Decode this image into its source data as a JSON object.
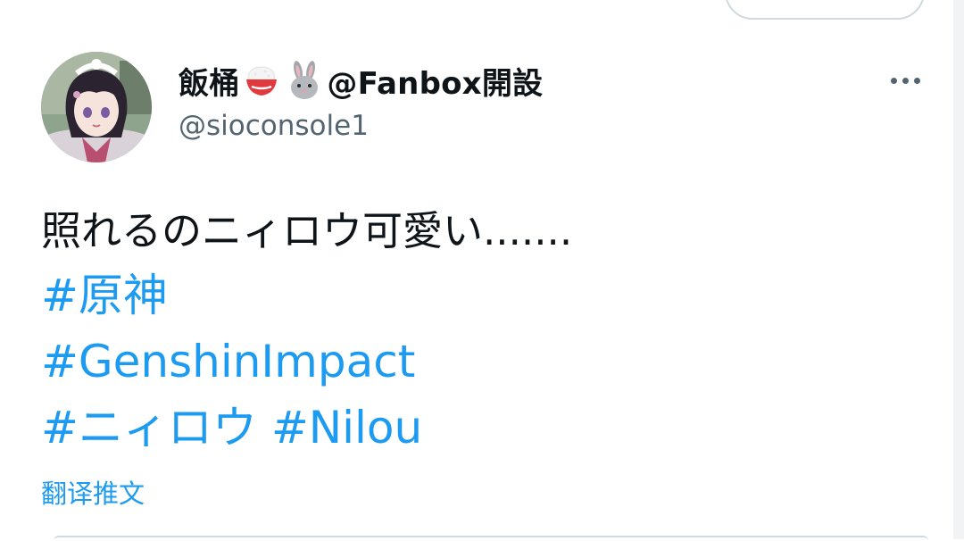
{
  "tweet": {
    "author": {
      "name_text": "飯桶",
      "name_emojis": [
        "rice-bowl-icon",
        "rabbit-icon"
      ],
      "name_suffix": "@Fanbox開設",
      "handle": "@sioconsole1"
    },
    "text": "照れるのニィロウ可愛い.......",
    "hashtags": [
      [
        "#原神"
      ],
      [
        "#GenshinImpact"
      ],
      [
        "#ニィロウ",
        "#Nilou"
      ]
    ],
    "translate_label": "翻译推文"
  },
  "colors": {
    "link": "#1d9bf0",
    "secondary_text": "#536471",
    "primary_text": "#0f1419",
    "border": "#cfd9de"
  },
  "icons": {
    "more": "more-horizontal-icon",
    "avatar": "avatar"
  }
}
